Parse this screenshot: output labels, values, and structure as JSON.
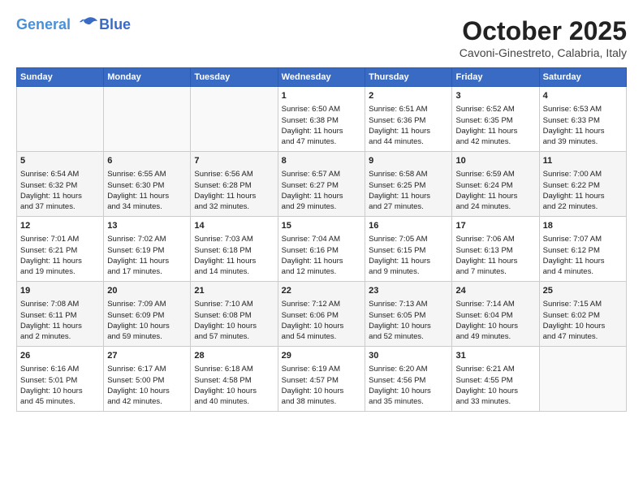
{
  "logo": {
    "line1": "General",
    "line2": "Blue"
  },
  "title": "October 2025",
  "subtitle": "Cavoni-Ginestreto, Calabria, Italy",
  "days_of_week": [
    "Sunday",
    "Monday",
    "Tuesday",
    "Wednesday",
    "Thursday",
    "Friday",
    "Saturday"
  ],
  "weeks": [
    [
      {
        "day": "",
        "content": ""
      },
      {
        "day": "",
        "content": ""
      },
      {
        "day": "",
        "content": ""
      },
      {
        "day": "1",
        "content": "Sunrise: 6:50 AM\nSunset: 6:38 PM\nDaylight: 11 hours\nand 47 minutes."
      },
      {
        "day": "2",
        "content": "Sunrise: 6:51 AM\nSunset: 6:36 PM\nDaylight: 11 hours\nand 44 minutes."
      },
      {
        "day": "3",
        "content": "Sunrise: 6:52 AM\nSunset: 6:35 PM\nDaylight: 11 hours\nand 42 minutes."
      },
      {
        "day": "4",
        "content": "Sunrise: 6:53 AM\nSunset: 6:33 PM\nDaylight: 11 hours\nand 39 minutes."
      }
    ],
    [
      {
        "day": "5",
        "content": "Sunrise: 6:54 AM\nSunset: 6:32 PM\nDaylight: 11 hours\nand 37 minutes."
      },
      {
        "day": "6",
        "content": "Sunrise: 6:55 AM\nSunset: 6:30 PM\nDaylight: 11 hours\nand 34 minutes."
      },
      {
        "day": "7",
        "content": "Sunrise: 6:56 AM\nSunset: 6:28 PM\nDaylight: 11 hours\nand 32 minutes."
      },
      {
        "day": "8",
        "content": "Sunrise: 6:57 AM\nSunset: 6:27 PM\nDaylight: 11 hours\nand 29 minutes."
      },
      {
        "day": "9",
        "content": "Sunrise: 6:58 AM\nSunset: 6:25 PM\nDaylight: 11 hours\nand 27 minutes."
      },
      {
        "day": "10",
        "content": "Sunrise: 6:59 AM\nSunset: 6:24 PM\nDaylight: 11 hours\nand 24 minutes."
      },
      {
        "day": "11",
        "content": "Sunrise: 7:00 AM\nSunset: 6:22 PM\nDaylight: 11 hours\nand 22 minutes."
      }
    ],
    [
      {
        "day": "12",
        "content": "Sunrise: 7:01 AM\nSunset: 6:21 PM\nDaylight: 11 hours\nand 19 minutes."
      },
      {
        "day": "13",
        "content": "Sunrise: 7:02 AM\nSunset: 6:19 PM\nDaylight: 11 hours\nand 17 minutes."
      },
      {
        "day": "14",
        "content": "Sunrise: 7:03 AM\nSunset: 6:18 PM\nDaylight: 11 hours\nand 14 minutes."
      },
      {
        "day": "15",
        "content": "Sunrise: 7:04 AM\nSunset: 6:16 PM\nDaylight: 11 hours\nand 12 minutes."
      },
      {
        "day": "16",
        "content": "Sunrise: 7:05 AM\nSunset: 6:15 PM\nDaylight: 11 hours\nand 9 minutes."
      },
      {
        "day": "17",
        "content": "Sunrise: 7:06 AM\nSunset: 6:13 PM\nDaylight: 11 hours\nand 7 minutes."
      },
      {
        "day": "18",
        "content": "Sunrise: 7:07 AM\nSunset: 6:12 PM\nDaylight: 11 hours\nand 4 minutes."
      }
    ],
    [
      {
        "day": "19",
        "content": "Sunrise: 7:08 AM\nSunset: 6:11 PM\nDaylight: 11 hours\nand 2 minutes."
      },
      {
        "day": "20",
        "content": "Sunrise: 7:09 AM\nSunset: 6:09 PM\nDaylight: 10 hours\nand 59 minutes."
      },
      {
        "day": "21",
        "content": "Sunrise: 7:10 AM\nSunset: 6:08 PM\nDaylight: 10 hours\nand 57 minutes."
      },
      {
        "day": "22",
        "content": "Sunrise: 7:12 AM\nSunset: 6:06 PM\nDaylight: 10 hours\nand 54 minutes."
      },
      {
        "day": "23",
        "content": "Sunrise: 7:13 AM\nSunset: 6:05 PM\nDaylight: 10 hours\nand 52 minutes."
      },
      {
        "day": "24",
        "content": "Sunrise: 7:14 AM\nSunset: 6:04 PM\nDaylight: 10 hours\nand 49 minutes."
      },
      {
        "day": "25",
        "content": "Sunrise: 7:15 AM\nSunset: 6:02 PM\nDaylight: 10 hours\nand 47 minutes."
      }
    ],
    [
      {
        "day": "26",
        "content": "Sunrise: 6:16 AM\nSunset: 5:01 PM\nDaylight: 10 hours\nand 45 minutes."
      },
      {
        "day": "27",
        "content": "Sunrise: 6:17 AM\nSunset: 5:00 PM\nDaylight: 10 hours\nand 42 minutes."
      },
      {
        "day": "28",
        "content": "Sunrise: 6:18 AM\nSunset: 4:58 PM\nDaylight: 10 hours\nand 40 minutes."
      },
      {
        "day": "29",
        "content": "Sunrise: 6:19 AM\nSunset: 4:57 PM\nDaylight: 10 hours\nand 38 minutes."
      },
      {
        "day": "30",
        "content": "Sunrise: 6:20 AM\nSunset: 4:56 PM\nDaylight: 10 hours\nand 35 minutes."
      },
      {
        "day": "31",
        "content": "Sunrise: 6:21 AM\nSunset: 4:55 PM\nDaylight: 10 hours\nand 33 minutes."
      },
      {
        "day": "",
        "content": ""
      }
    ]
  ]
}
